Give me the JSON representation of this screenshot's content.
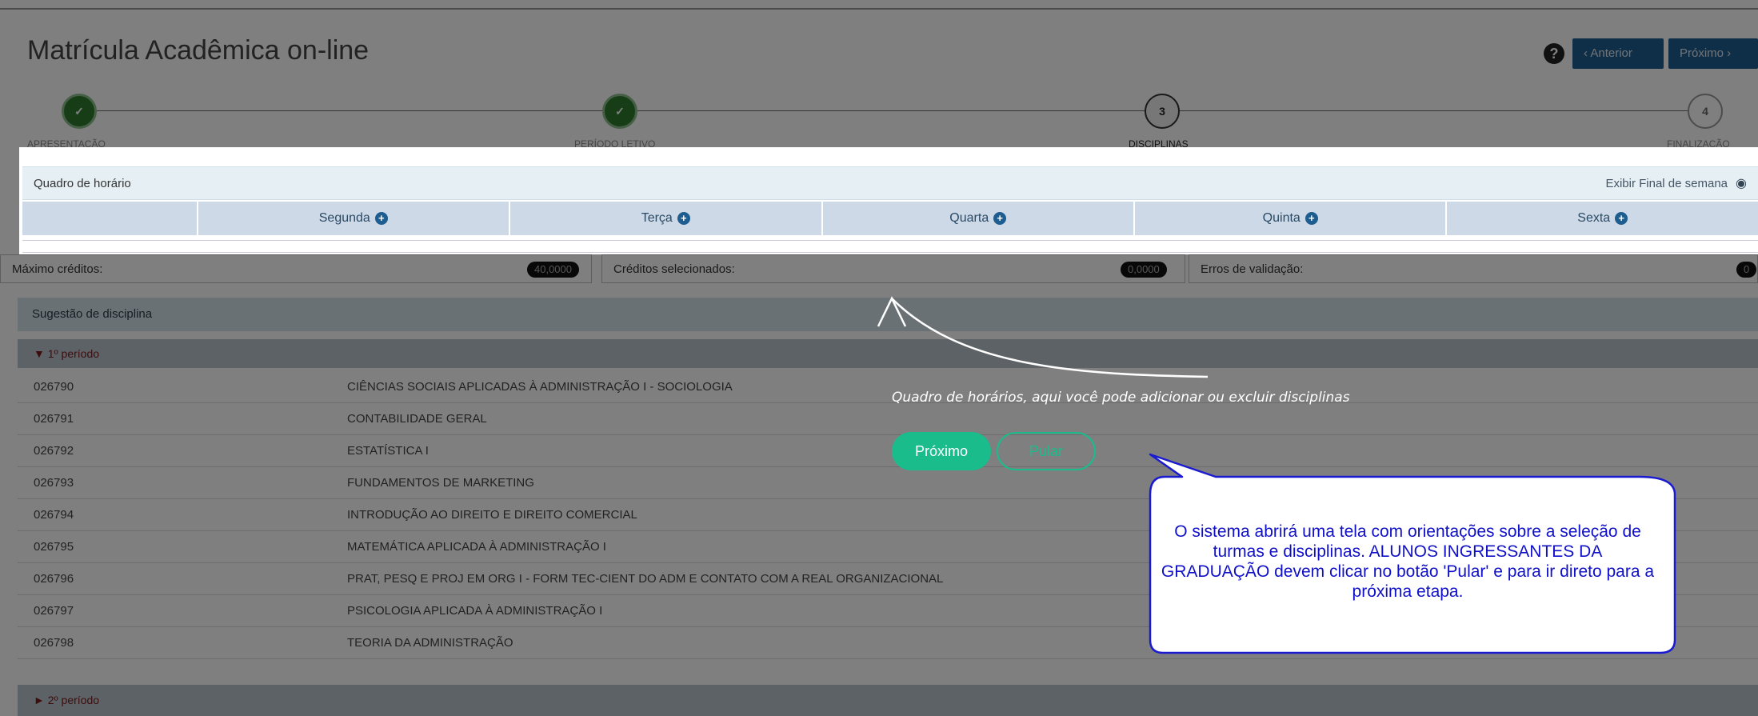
{
  "page": {
    "title": "Matrícula Acadêmica on-line",
    "nav": {
      "prev_label": "Anterior",
      "next_label": "Próximo"
    }
  },
  "steps": [
    {
      "label": "APRESENTAÇÃO",
      "number": "",
      "status": "done"
    },
    {
      "label": "PERÍODO LETIVO",
      "number": "",
      "status": "done"
    },
    {
      "label": "DISCIPLINAS",
      "number": "3",
      "status": "current"
    },
    {
      "label": "FINALIZAÇÃO",
      "number": "4",
      "status": "future"
    }
  ],
  "schedule": {
    "title": "Quadro de horário",
    "weekend_toggle": "Exibir Final de semana",
    "days": [
      "Segunda",
      "Terça",
      "Quarta",
      "Quinta",
      "Sexta"
    ]
  },
  "credits": {
    "max_label": "Máximo créditos:",
    "max_value": "40,0000",
    "selected_label": "Créditos selecionados:",
    "selected_value": "0,0000",
    "errors_label": "Erros de validação:",
    "errors_value": "0"
  },
  "suggestion": {
    "title": "Sugestão de disciplina",
    "period1": "1º período",
    "period2": "2º período",
    "rows": [
      {
        "code": "026790",
        "name": "CIÊNCIAS SOCIAIS APLICADAS À ADMINISTRAÇÃO I - SOCIOLOGIA"
      },
      {
        "code": "026791",
        "name": "CONTABILIDADE GERAL"
      },
      {
        "code": "026792",
        "name": "ESTATÍSTICA I"
      },
      {
        "code": "026793",
        "name": "FUNDAMENTOS DE MARKETING"
      },
      {
        "code": "026794",
        "name": "INTRODUÇÃO AO DIREITO E DIREITO COMERCIAL"
      },
      {
        "code": "026795",
        "name": "MATEMÁTICA APLICADA À ADMINISTRAÇÃO I"
      },
      {
        "code": "026796",
        "name": "PRAT, PESQ E PROJ EM ORG I - FORM TEC-CIENT DO ADM E CONTATO COM A REAL ORGANIZACIONAL"
      },
      {
        "code": "026797",
        "name": "PSICOLOGIA APLICADA À ADMINISTRAÇÃO I"
      },
      {
        "code": "026798",
        "name": "TEORIA DA ADMINISTRAÇÃO"
      }
    ]
  },
  "tour": {
    "text": "Quadro de horários, aqui você pode adicionar ou excluir disciplinas",
    "next_label": "Próximo",
    "skip_label": "Pular"
  },
  "callout": {
    "text": "O sistema abrirá uma tela com orientações sobre a seleção de turmas e disciplinas. ALUNOS INGRESSANTES DA GRADUAÇÃO devem clicar no botão 'Pular' e para ir direto para a próxima etapa."
  },
  "colors": {
    "primary": "#1e5d8f",
    "tour_accent": "#1abc8c",
    "callout_text": "#1010c8"
  }
}
